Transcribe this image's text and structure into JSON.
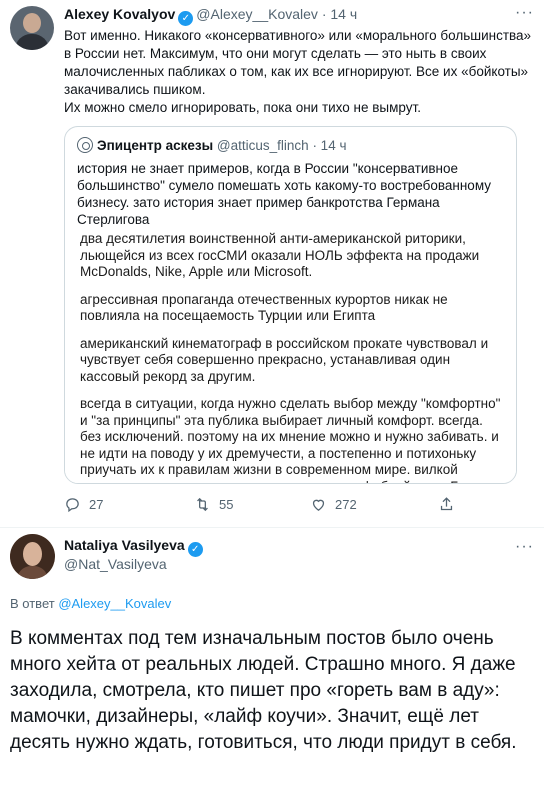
{
  "tweet1": {
    "author_name": "Alexey Kovalyov",
    "handle": "@Alexey__Kovalev",
    "time": "· 14 ч",
    "text_p1": "Вот именно. Никакого «консервативного» или «морального большинства» в России нет. Максимум, что они могут сделать — это ныть в своих малочисленных пабликах о том, как их все игнорируют. Все их «бойкоты» закачивались пшиком.",
    "text_p2": "Их можно смело игнорировать, пока они тихо не вымрут.",
    "quote": {
      "author_name": "Эпицентр аскезы",
      "handle": "@atticus_flinch",
      "time": "· 14 ч",
      "text": "история не знает примеров, когда в России \"консервативное большинство\" сумело помешать хоть какому-то востребованному бизнесу. зато история знает пример банкротства Германа Стерлигова",
      "image_paragraphs": [
        "два десятилетия воинственной анти-американской риторики, льющейся из всех госСМИ оказали НОЛЬ эффекта на продажи McDonalds, Nike, Apple или Microsoft.",
        "агрессивная пропаганда отечественных курортов никак не повлияла на посещаемость Турции или Египта",
        "американский кинематограф в российском прокате чувствовал и чувствует себя совершенно прекрасно, устанавливая один кассовый рекорд за другим.",
        "всегда в ситуации, когда нужно сделать выбор между \"комфортно\" и \"за принципы\" эта публика выбирает личный комфорт. всегда. без исключений. поэтому на их мнение можно и нужно забивать. и не идти на поводу у их дремучести, а постепенно и потихоньку приучать их к правилам жизни в современном мире. вилкой пользоваться ведь научились как-то, из гомофобией, даст Бог"
      ]
    },
    "actions": {
      "replies": "27",
      "retweets": "55",
      "likes": "272"
    }
  },
  "tweet2": {
    "author_name": "Nataliya Vasilyeva",
    "handle": "@Nat_Vasilyeva",
    "reply_prefix": "В ответ ",
    "reply_to": "@Alexey__Kovalev",
    "text": "В комментах под тем изначальным постов было очень много хейта от реальных людей. Страшно много. Я даже заходила, смотрела, кто пишет про «гореть вам в аду»: мамочки, дизайнеры, «лайф коучи». Значит, ещё лет десять нужно ждать, готовиться, что люди придут в себя."
  },
  "icons": {
    "more": "more-icon",
    "verified": "verified-badge-icon",
    "reply": "reply-icon",
    "retweet": "retweet-icon",
    "like": "heart-icon",
    "share": "share-icon"
  },
  "colors": {
    "accent": "#1d9bf0",
    "secondary_text": "#536471",
    "border": "#cfd9de"
  }
}
